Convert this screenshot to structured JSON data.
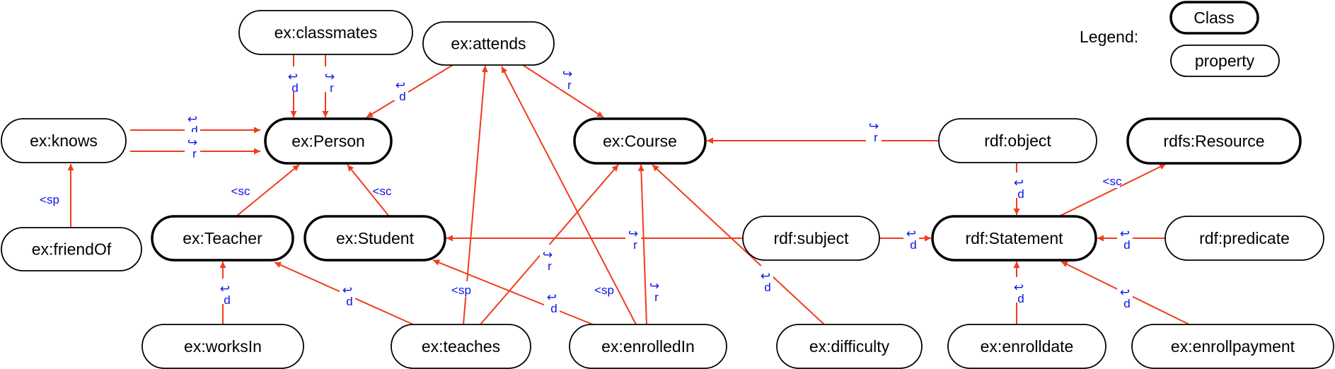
{
  "diagram": {
    "colors": {
      "edge": "#f03c1e",
      "edge_label": "#0a14e6",
      "node_border": "#000000"
    },
    "legend": {
      "title": "Legend:",
      "class_label": "Class",
      "property_label": "property"
    },
    "nodes": [
      {
        "id": "classmates",
        "label": "ex:classmates",
        "kind": "property"
      },
      {
        "id": "attends",
        "label": "ex:attends",
        "kind": "property"
      },
      {
        "id": "knows",
        "label": "ex:knows",
        "kind": "property"
      },
      {
        "id": "person",
        "label": "ex:Person",
        "kind": "class"
      },
      {
        "id": "course",
        "label": "ex:Course",
        "kind": "class"
      },
      {
        "id": "object",
        "label": "rdf:object",
        "kind": "property"
      },
      {
        "id": "resource",
        "label": "rdfs:Resource",
        "kind": "class"
      },
      {
        "id": "friendOf",
        "label": "ex:friendOf",
        "kind": "property"
      },
      {
        "id": "teacher",
        "label": "ex:Teacher",
        "kind": "class"
      },
      {
        "id": "student",
        "label": "ex:Student",
        "kind": "class"
      },
      {
        "id": "subject",
        "label": "rdf:subject",
        "kind": "property"
      },
      {
        "id": "statement",
        "label": "rdf:Statement",
        "kind": "class"
      },
      {
        "id": "predicate",
        "label": "rdf:predicate",
        "kind": "property"
      },
      {
        "id": "worksIn",
        "label": "ex:worksIn",
        "kind": "property"
      },
      {
        "id": "teaches",
        "label": "ex:teaches",
        "kind": "property"
      },
      {
        "id": "enrolledIn",
        "label": "ex:enrolledIn",
        "kind": "property"
      },
      {
        "id": "difficulty",
        "label": "ex:difficulty",
        "kind": "property"
      },
      {
        "id": "enrolldate",
        "label": "ex:enrolldate",
        "kind": "property"
      },
      {
        "id": "enrollpayment",
        "label": "ex:enrollpayment",
        "kind": "property"
      }
    ],
    "edges": [
      {
        "from": "classmates",
        "to": "person",
        "label": "d"
      },
      {
        "from": "classmates",
        "to": "person",
        "label": "r"
      },
      {
        "from": "knows",
        "to": "person",
        "label": "d"
      },
      {
        "from": "knows",
        "to": "person",
        "label": "r"
      },
      {
        "from": "attends",
        "to": "person",
        "label": "d"
      },
      {
        "from": "attends",
        "to": "course",
        "label": "r"
      },
      {
        "from": "friendOf",
        "to": "knows",
        "label": "<sp"
      },
      {
        "from": "teacher",
        "to": "person",
        "label": "<sc"
      },
      {
        "from": "student",
        "to": "person",
        "label": "<sc"
      },
      {
        "from": "worksIn",
        "to": "teacher",
        "label": "d"
      },
      {
        "from": "teaches",
        "to": "teacher",
        "label": "d"
      },
      {
        "from": "teaches",
        "to": "attends",
        "label": "<sp"
      },
      {
        "from": "teaches",
        "to": "course",
        "label": "r"
      },
      {
        "from": "enrolledIn",
        "to": "student",
        "label": "d"
      },
      {
        "from": "enrolledIn",
        "to": "attends",
        "label": "<sp"
      },
      {
        "from": "enrolledIn",
        "to": "course",
        "label": "r"
      },
      {
        "from": "difficulty",
        "to": "course",
        "label": "d"
      },
      {
        "from": "subject",
        "to": "student",
        "label": "r"
      },
      {
        "from": "subject",
        "to": "statement",
        "label": "d"
      },
      {
        "from": "object",
        "to": "course",
        "label": "r"
      },
      {
        "from": "object",
        "to": "statement",
        "label": "d"
      },
      {
        "from": "statement",
        "to": "resource",
        "label": "<sc"
      },
      {
        "from": "predicate",
        "to": "statement",
        "label": "d"
      },
      {
        "from": "enrolldate",
        "to": "statement",
        "label": "d"
      },
      {
        "from": "enrollpayment",
        "to": "statement",
        "label": "d"
      }
    ]
  }
}
